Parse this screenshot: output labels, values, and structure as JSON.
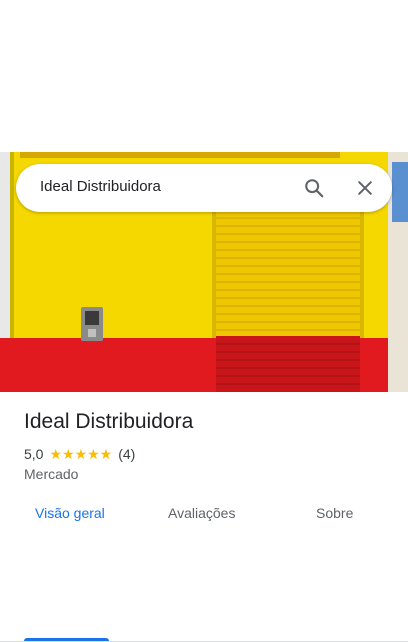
{
  "search": {
    "query": "Ideal Distribuidora"
  },
  "place": {
    "name": "Ideal Distribuidora",
    "rating": "5,0",
    "stars": "★★★★★",
    "review_count": "(4)",
    "category": "Mercado"
  },
  "tabs": [
    {
      "label": "Visão geral",
      "active": true
    },
    {
      "label": "Avaliações",
      "active": false
    },
    {
      "label": "Sobre",
      "active": false
    }
  ],
  "colors": {
    "accent": "#1a73e8",
    "star": "#fbbc04",
    "wall_yellow": "#f5d800",
    "wall_red": "#e01a1f"
  },
  "icons": {
    "search": "search-icon",
    "close": "close-icon"
  }
}
